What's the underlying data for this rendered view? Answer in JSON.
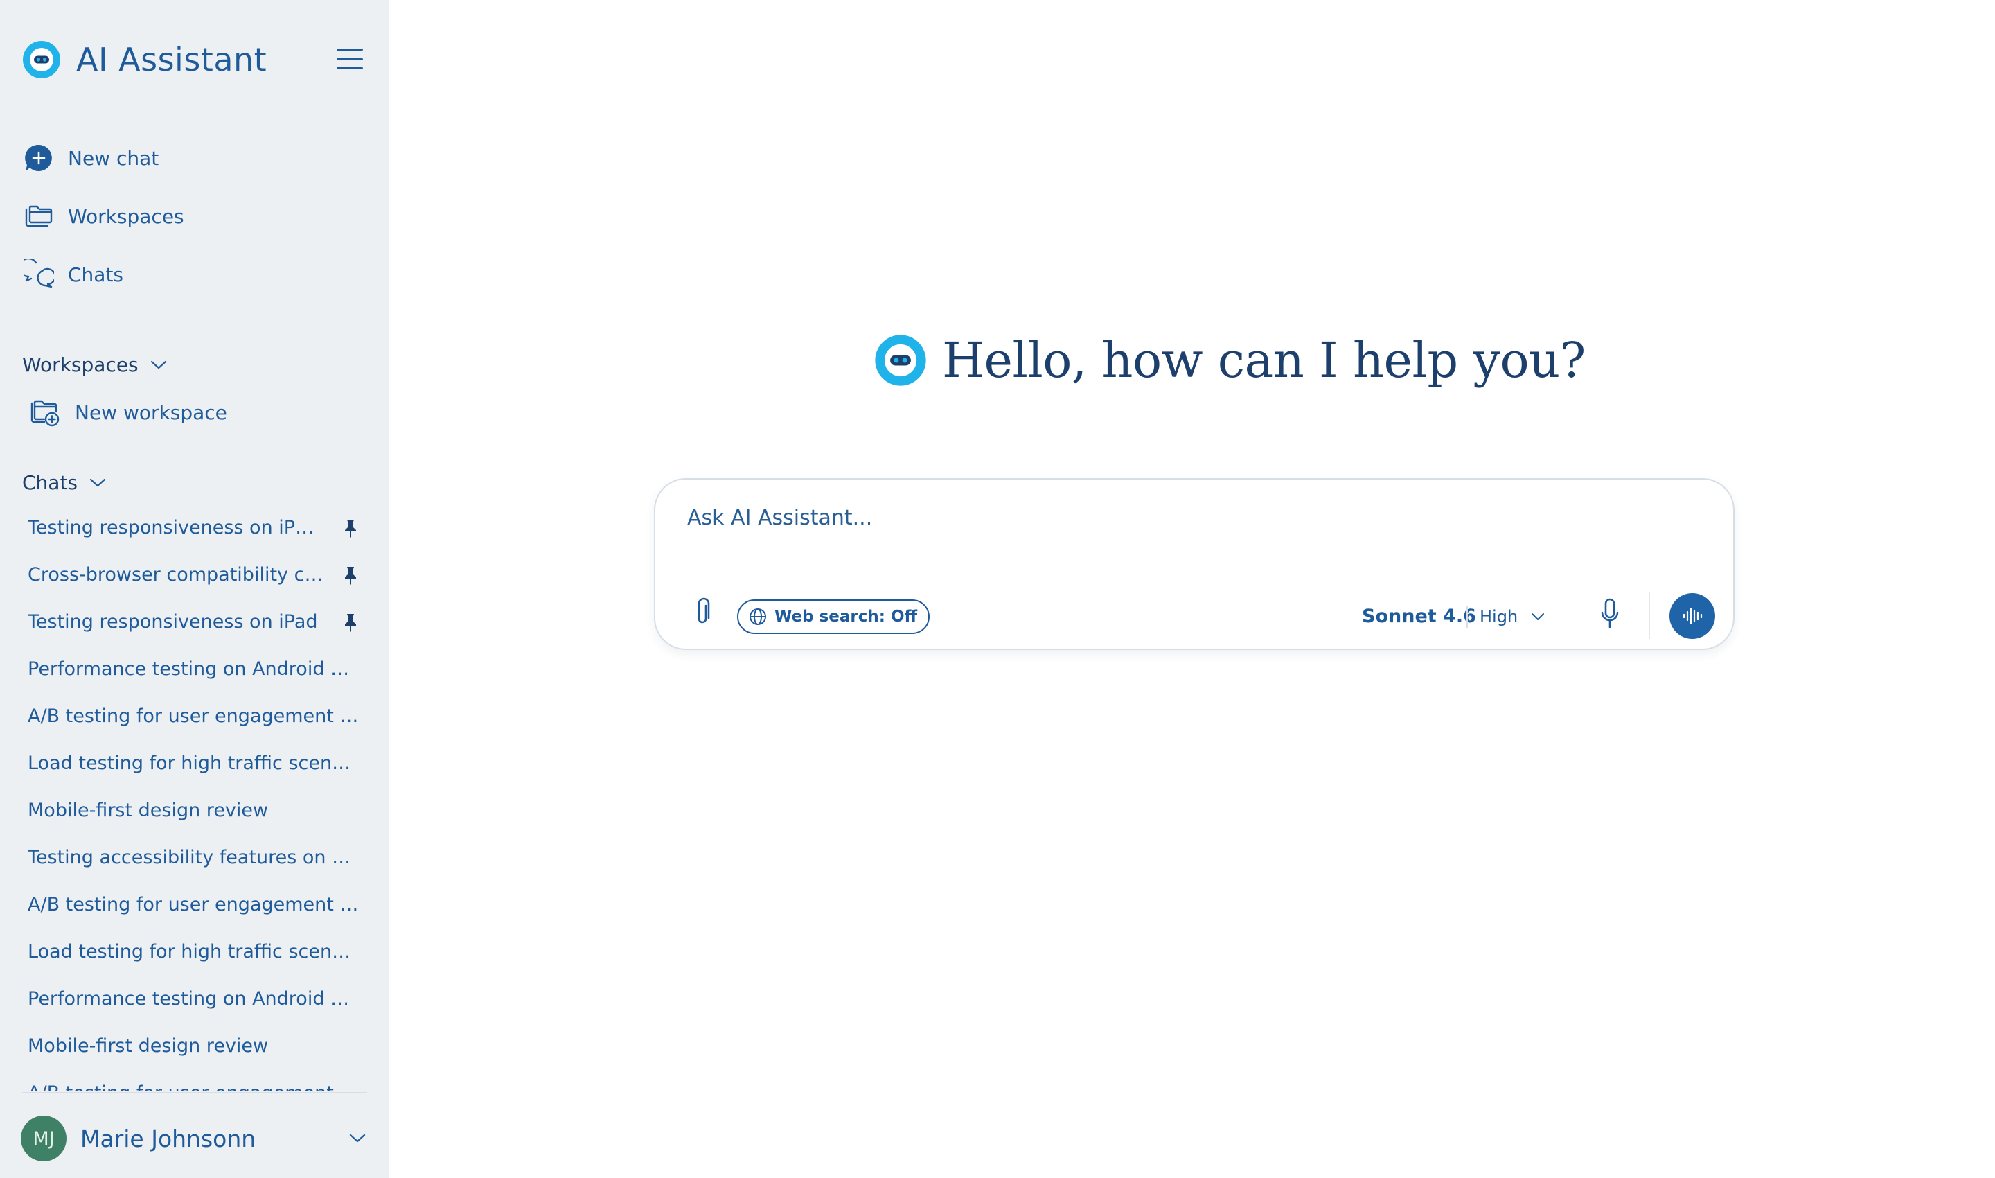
{
  "app": {
    "title": "AI Assistant"
  },
  "nav": {
    "new_chat": "New chat",
    "workspaces": "Workspaces",
    "chats": "Chats"
  },
  "workspaces_section": {
    "title": "Workspaces",
    "new_workspace": "New workspace"
  },
  "chats_section": {
    "title": "Chats",
    "items": [
      {
        "label": "Testing responsiveness on iPhone",
        "pinned": true
      },
      {
        "label": "Cross-browser compatibility che…",
        "pinned": true
      },
      {
        "label": "Testing responsiveness on iPad",
        "pinned": true
      },
      {
        "label": "Performance testing on Android devi…",
        "pinned": false
      },
      {
        "label": "A/B testing for user engagement met…",
        "pinned": false
      },
      {
        "label": "Load testing for high traffic scenarios",
        "pinned": false
      },
      {
        "label": "Mobile-first design review",
        "pinned": false
      },
      {
        "label": "Testing accessibility features on Win…",
        "pinned": false
      },
      {
        "label": "A/B testing for user engagement met…",
        "pinned": false
      },
      {
        "label": "Load testing for high traffic scenarios",
        "pinned": false
      },
      {
        "label": "Performance testing on Android devi…",
        "pinned": false
      },
      {
        "label": "Mobile-first design review",
        "pinned": false
      },
      {
        "label": "A/B testing for user engagement met…",
        "pinned": false
      }
    ]
  },
  "user": {
    "initials": "MJ",
    "name": "Marie Johnsonn"
  },
  "main": {
    "greeting": "Hello, how can I help you?",
    "composer": {
      "placeholder": "Ask AI Assistant...",
      "web_search_label": "Web search: Off",
      "model": "Sonnet 4.6",
      "effort": "High"
    }
  },
  "colors": {
    "sidebar_bg": "#edf0f3",
    "accent": "#1f5b9a",
    "voice_button": "#1f63a8",
    "avatar_bg": "#3f8167",
    "logo_cyan": "#1fb3ea"
  }
}
